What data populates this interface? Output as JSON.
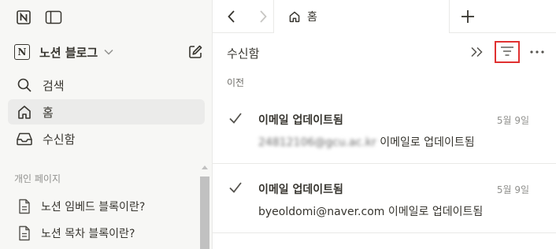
{
  "sidebar": {
    "workspace_name": "노션 블로그",
    "logo_letter": "N",
    "nav": [
      {
        "label": "검색",
        "icon": "search-icon"
      },
      {
        "label": "홈",
        "icon": "home-icon"
      },
      {
        "label": "수신함",
        "icon": "inbox-icon"
      }
    ],
    "section_label": "개인 페이지",
    "pages": [
      {
        "label": "노션 임베드 블록이란?",
        "icon": "page-icon"
      },
      {
        "label": "노션 목차 블록이란?",
        "icon": "page-icon"
      }
    ]
  },
  "tabbar": {
    "tab_label": "홈"
  },
  "inbox": {
    "title": "수신함",
    "group_label": "이전",
    "notifications": [
      {
        "title": "이메일 업데이트됨",
        "date": "5월 9일",
        "email": "24812106@gcu.ac.kr",
        "suffix": " 이메일로 업데이트됨"
      },
      {
        "title": "이메일 업데이트됨",
        "date": "5월 9일",
        "email": "byeoldomi@naver.com",
        "suffix": " 이메일로 업데이트됨"
      }
    ]
  },
  "colors": {
    "highlight": "#e03131",
    "sidebar_bg": "#f7f7f5",
    "active_bg": "#ebebea"
  }
}
